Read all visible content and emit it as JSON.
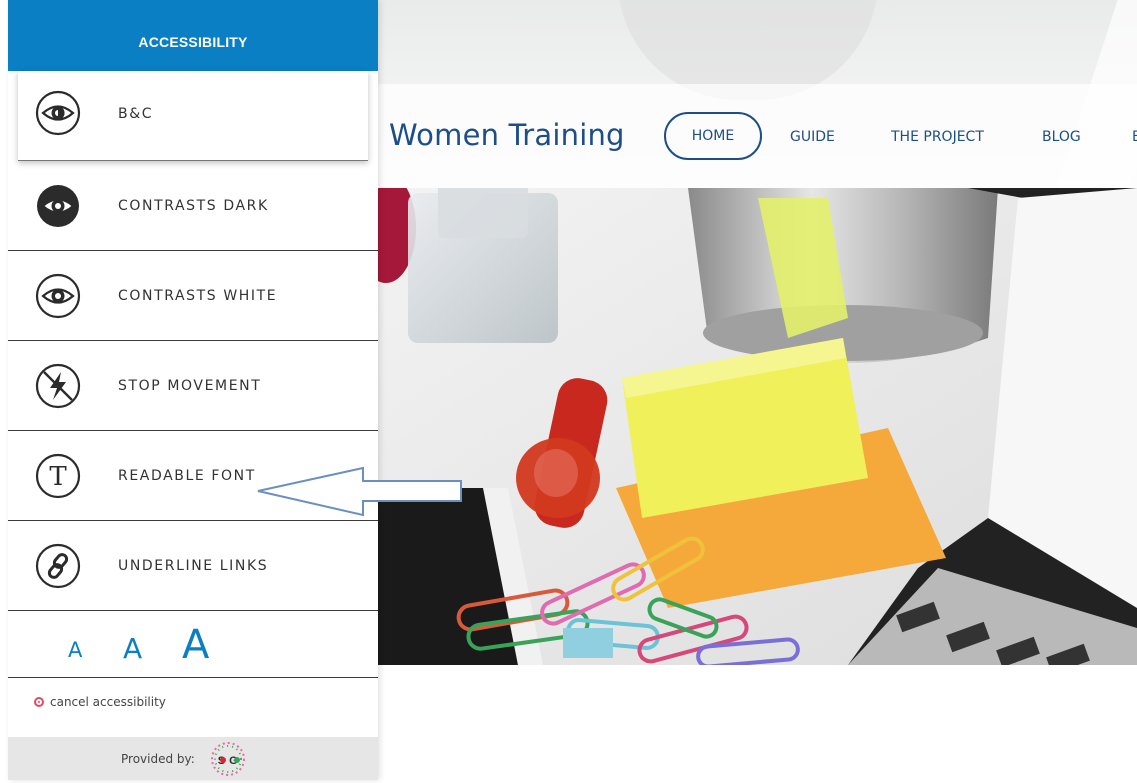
{
  "panel": {
    "title": "ACCESSIBILITY",
    "options": [
      {
        "label": "B&C",
        "icon": "eye-outline-icon"
      },
      {
        "label": "CONTRASTS DARK",
        "icon": "eye-dark-icon"
      },
      {
        "label": "CONTRASTS WHITE",
        "icon": "eye-white-icon"
      },
      {
        "label": "STOP MOVEMENT",
        "icon": "no-flash-icon"
      },
      {
        "label": "READABLE FONT",
        "icon": "font-t-icon"
      },
      {
        "label": "UNDERLINE LINKS",
        "icon": "link-icon"
      }
    ],
    "font_sizes": [
      "A",
      "A",
      "A"
    ],
    "cancel_label": "cancel accessibility",
    "provided_by": "Provided by:",
    "logo_text": "SOGO"
  },
  "site": {
    "title": "Women Training",
    "nav": [
      "HOME",
      "GUIDE",
      "THE PROJECT",
      "BLOG",
      "E"
    ]
  },
  "colors": {
    "accent": "#0b7fc4",
    "site_blue": "#1d4e88",
    "cancel_red": "#e84a5f"
  }
}
